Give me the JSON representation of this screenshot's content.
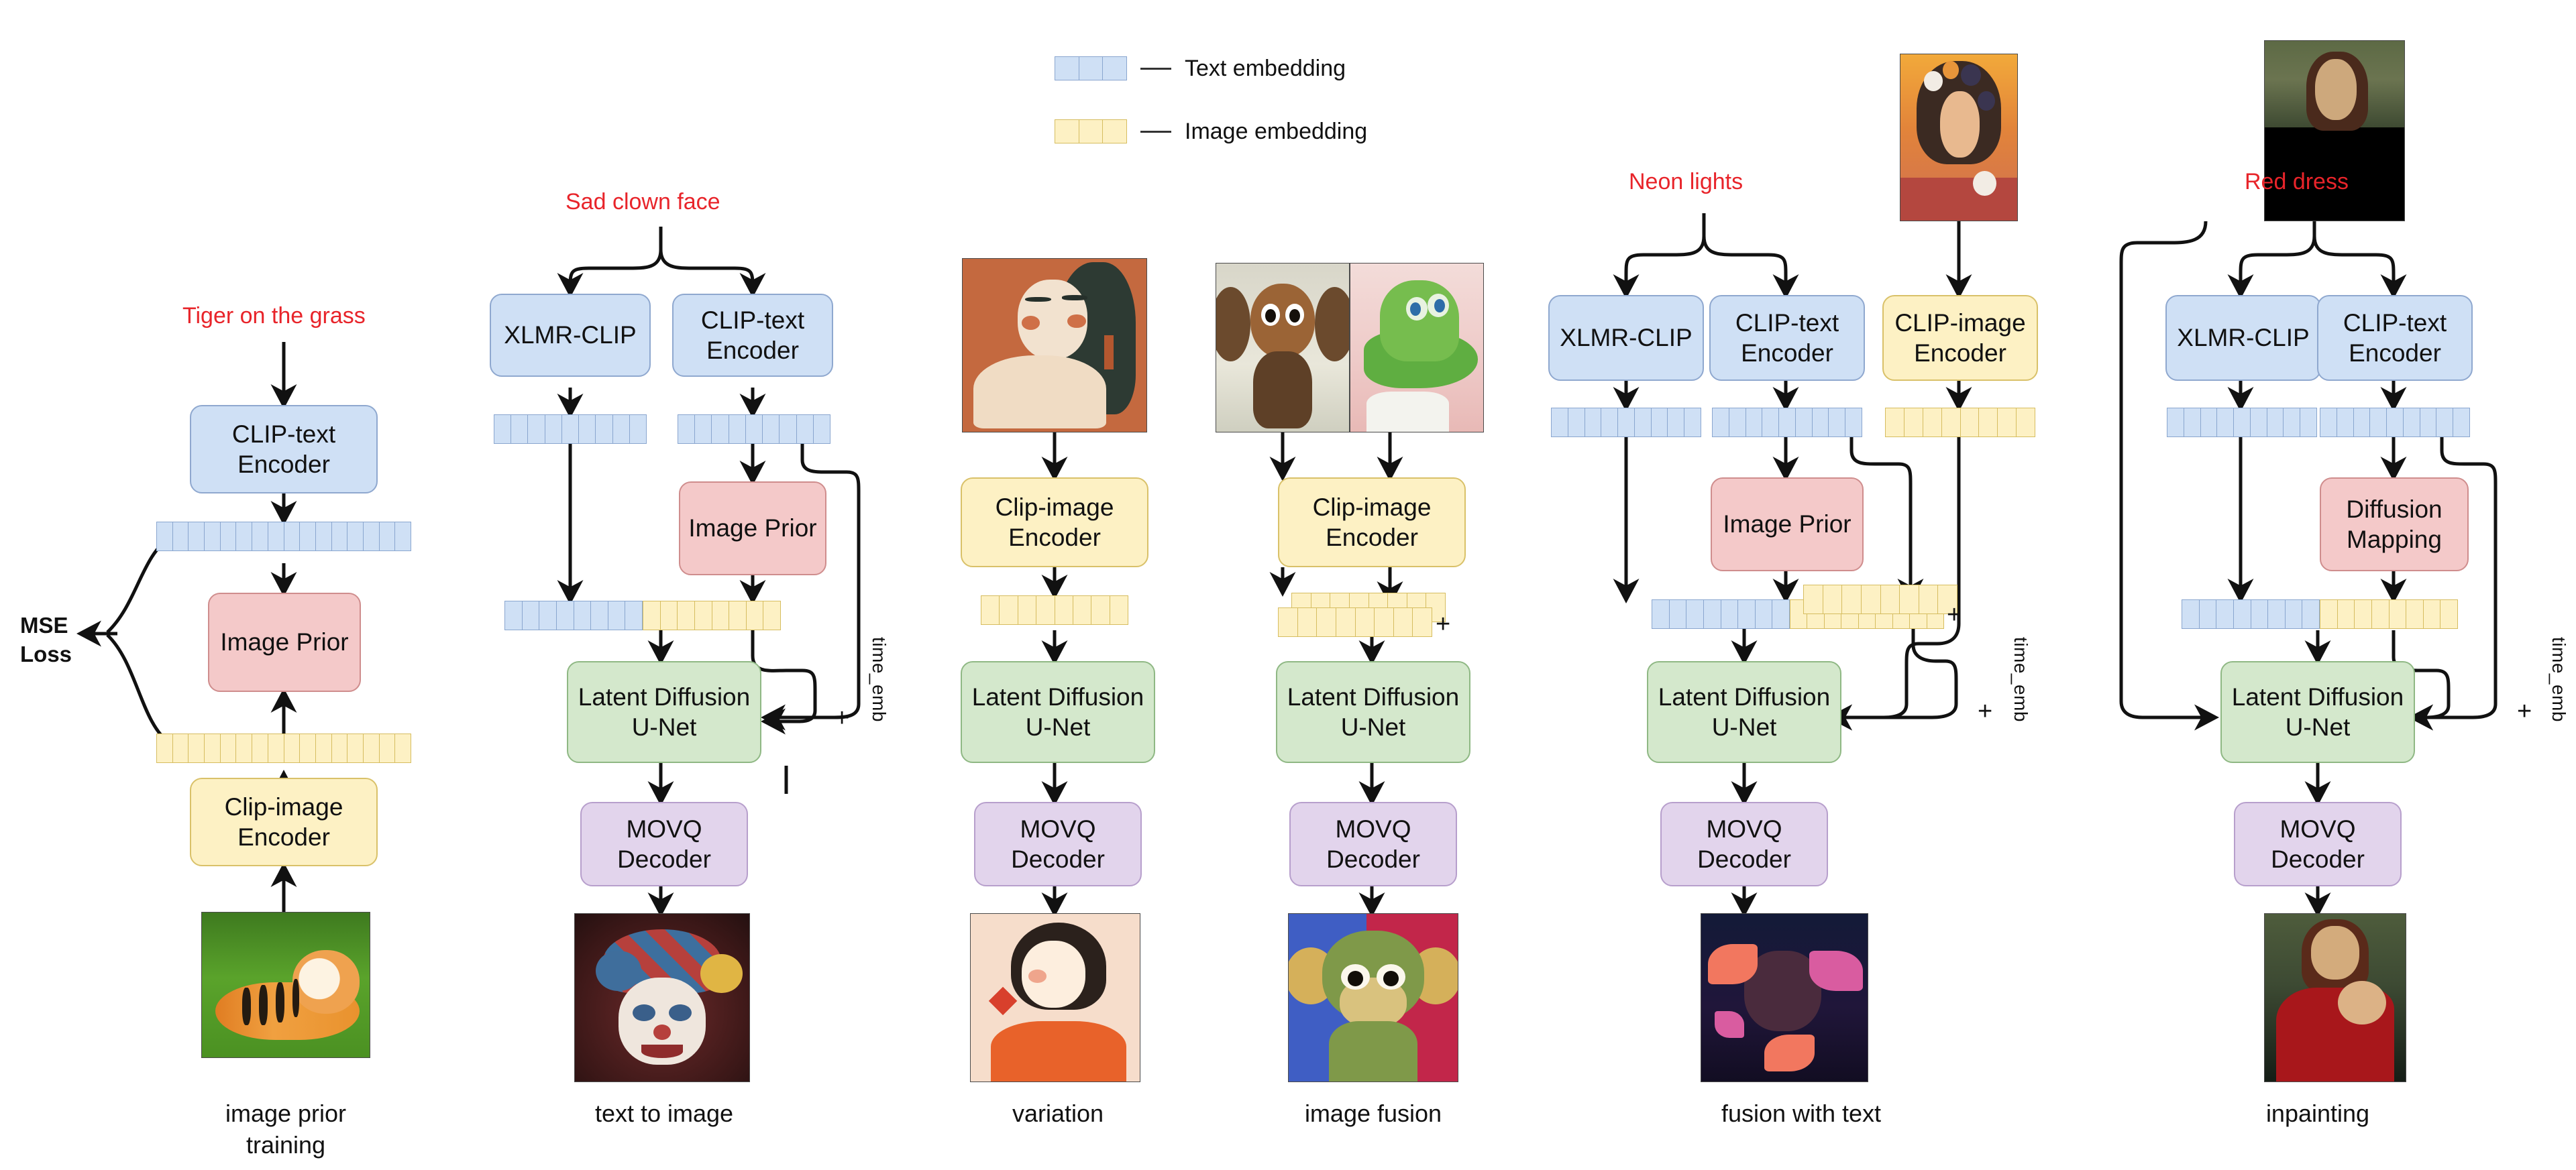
{
  "legend": {
    "items": [
      {
        "swatch": "text-embedding-swatch",
        "dash": "—",
        "label": "Text embedding"
      },
      {
        "swatch": "image-embedding-swatch",
        "dash": "—",
        "label": "Image embedding"
      }
    ]
  },
  "colors": {
    "text_embedding": "#cfe0f5",
    "image_embedding": "#fdf1c4",
    "prior_box": "#f4c9c9",
    "unet_box": "#d4e8cc",
    "decoder_box": "#e2d4ec",
    "prompt_text": "#e8242a"
  },
  "columns": [
    {
      "id": "image-prior-training",
      "caption": "image prior\ntraining",
      "prompt": "Tiger on the grass",
      "loss_label": "MSE\nLoss",
      "nodes": [
        {
          "name": "clip-text-encoder",
          "label": "CLIP-text\nEncoder",
          "color": "blue"
        },
        {
          "name": "image-prior",
          "label": "Image Prior",
          "color": "pink"
        },
        {
          "name": "clip-image-encoder",
          "label": "Clip-image\nEncoder",
          "color": "yellow"
        }
      ],
      "embeddings": [
        {
          "name": "text-embedding-bar",
          "type": "text",
          "cells": 16
        },
        {
          "name": "image-embedding-bar",
          "type": "image",
          "cells": 16
        }
      ],
      "images": [
        {
          "name": "input-image-tiger",
          "alt": "tiger on the grass photo"
        }
      ]
    },
    {
      "id": "text-to-image",
      "caption": "text to image",
      "prompt": "Sad clown face",
      "time_emb_label": "time_emb",
      "plus": "+",
      "nodes": [
        {
          "name": "xlmr-clip",
          "label": "XLMR-CLIP",
          "color": "blue"
        },
        {
          "name": "clip-text-encoder",
          "label": "CLIP-text\nEncoder",
          "color": "blue"
        },
        {
          "name": "image-prior",
          "label": "Image Prior",
          "color": "pink"
        },
        {
          "name": "latent-diffusion-unet",
          "label": "Latent Diffusion\nU-Net",
          "color": "green"
        },
        {
          "name": "movq-decoder",
          "label": "MOVQ\nDecoder",
          "color": "purple"
        }
      ],
      "embeddings": [
        {
          "name": "xlmr-text-embedding-bar",
          "type": "text",
          "cells": 9
        },
        {
          "name": "clip-text-embedding-bar",
          "type": "text",
          "cells": 9
        },
        {
          "name": "concat-embedding-bar",
          "type": "mixed",
          "text_cells": 8,
          "image_cells": 8
        }
      ],
      "images": [
        {
          "name": "output-image-clown",
          "alt": "sad clown face"
        }
      ]
    },
    {
      "id": "variation",
      "caption": "variation",
      "nodes": [
        {
          "name": "clip-image-encoder",
          "label": "Clip-image\nEncoder",
          "color": "yellow"
        },
        {
          "name": "latent-diffusion-unet",
          "label": "Latent Diffusion\nU-Net",
          "color": "green"
        },
        {
          "name": "movq-decoder",
          "label": "MOVQ\nDecoder",
          "color": "purple"
        }
      ],
      "embeddings": [
        {
          "name": "image-embedding-bar",
          "type": "image",
          "cells": 8
        }
      ],
      "images": [
        {
          "name": "input-image-artgirl",
          "alt": "illustrated woman on orange background"
        },
        {
          "name": "output-image-artgirl-variation",
          "alt": "variation of illustrated woman"
        }
      ]
    },
    {
      "id": "image-fusion",
      "caption": "image fusion",
      "plus": "+",
      "nodes": [
        {
          "name": "clip-image-encoder",
          "label": "Clip-image\nEncoder",
          "color": "yellow"
        },
        {
          "name": "latent-diffusion-unet",
          "label": "Latent Diffusion\nU-Net",
          "color": "green"
        },
        {
          "name": "movq-decoder",
          "label": "MOVQ\nDecoder",
          "color": "purple"
        }
      ],
      "embeddings": [
        {
          "name": "image-embedding-bar-a",
          "type": "image",
          "cells": 8
        },
        {
          "name": "image-embedding-bar-b",
          "type": "image",
          "cells": 8
        }
      ],
      "images": [
        {
          "name": "input-image-cheburashka",
          "alt": "brown puppet character"
        },
        {
          "name": "input-image-crocodile",
          "alt": "green crocodile puppet"
        },
        {
          "name": "output-image-fused-creature",
          "alt": "fused green creature"
        }
      ]
    },
    {
      "id": "fusion-with-text",
      "caption": "fusion with text",
      "prompt": "Neon lights",
      "time_emb_label": "time_emb",
      "plus": "+",
      "plus_emb": "+",
      "nodes": [
        {
          "name": "xlmr-clip",
          "label": "XLMR-CLIP",
          "color": "blue"
        },
        {
          "name": "clip-text-encoder",
          "label": "CLIP-text\nEncoder",
          "color": "blue"
        },
        {
          "name": "clip-image-encoder",
          "label": "CLIP-image\nEncoder",
          "color": "yellow"
        },
        {
          "name": "image-prior",
          "label": "Image Prior",
          "color": "pink"
        },
        {
          "name": "latent-diffusion-unet",
          "label": "Latent Diffusion\nU-Net",
          "color": "green"
        },
        {
          "name": "movq-decoder",
          "label": "MOVQ\nDecoder",
          "color": "purple"
        }
      ],
      "embeddings": [
        {
          "name": "xlmr-text-embedding-bar",
          "type": "text",
          "cells": 9
        },
        {
          "name": "clip-text-embedding-bar",
          "type": "text",
          "cells": 9
        },
        {
          "name": "clip-image-embedding-bar",
          "type": "image",
          "cells": 8
        },
        {
          "name": "concat-embedding-bar",
          "type": "mixed",
          "text_cells": 8,
          "image_cells": 9
        },
        {
          "name": "prior-image-embedding-bar",
          "type": "image",
          "cells": 8
        }
      ],
      "images": [
        {
          "name": "input-image-model-flowers",
          "alt": "woman with flowers in hair"
        },
        {
          "name": "output-image-neon-flowers",
          "alt": "neon lit face with flowers"
        }
      ]
    },
    {
      "id": "inpainting",
      "caption": "inpainting",
      "prompt": "Red dress",
      "time_emb_label": "time_emb",
      "plus": "+",
      "nodes": [
        {
          "name": "xlmr-clip",
          "label": "XLMR-CLIP",
          "color": "blue"
        },
        {
          "name": "clip-text-encoder",
          "label": "CLIP-text\nEncoder",
          "color": "blue"
        },
        {
          "name": "diffusion-mapping",
          "label": "Diffusion\nMapping",
          "color": "pink"
        },
        {
          "name": "latent-diffusion-unet",
          "label": "Latent Diffusion\nU-Net",
          "color": "green"
        },
        {
          "name": "movq-decoder",
          "label": "MOVQ\nDecoder",
          "color": "purple"
        }
      ],
      "embeddings": [
        {
          "name": "xlmr-text-embedding-bar",
          "type": "text",
          "cells": 9
        },
        {
          "name": "clip-text-embedding-bar",
          "type": "text",
          "cells": 9
        },
        {
          "name": "concat-embedding-bar",
          "type": "mixed",
          "text_cells": 8,
          "image_cells": 8
        }
      ],
      "images": [
        {
          "name": "input-image-mona-masked",
          "alt": "masked Mona Lisa"
        },
        {
          "name": "output-image-mona-red-dress",
          "alt": "Mona Lisa in red dress"
        }
      ]
    }
  ]
}
